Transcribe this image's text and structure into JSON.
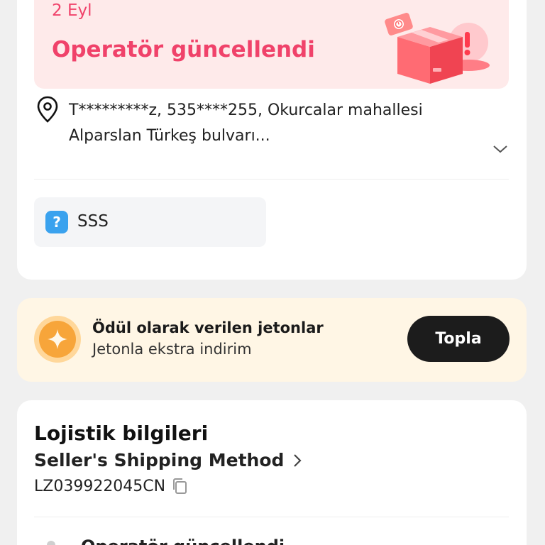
{
  "status": {
    "date": "2 Eyl",
    "title": "Operatör güncellendi"
  },
  "address": {
    "line1": "T*********z,  535****255,  Okurcalar mahallesi",
    "line2": "Alparslan Türkeş bulvarı..."
  },
  "faq": {
    "icon_glyph": "?",
    "label": "SSS"
  },
  "coins": {
    "title": "Ödül olarak verilen jetonlar",
    "subtitle": "Jetonla ekstra indirim",
    "button_label": "Topla"
  },
  "logistics": {
    "heading": "Lojistik bilgileri",
    "shipping_method": "Seller's Shipping Method",
    "tracking_number": "LZ039922045CN",
    "latest_event": "Operatör güncellendi"
  },
  "icons": {
    "pin": "location-pin-icon",
    "chevron_down": "chevron-down-icon",
    "help": "question-mark-icon",
    "coin": "coin-star-icon",
    "chevron_right": "chevron-right-icon",
    "copy": "copy-icon",
    "illustration": "parcel-box-icon"
  },
  "colors": {
    "status_accent": "#f0426a",
    "status_bg": "#feeaea",
    "coins_bg": "#fff6e5",
    "coin_orange": "#f7a53a",
    "button_dark": "#1c1c1c",
    "help_blue": "#3aa2ee"
  }
}
